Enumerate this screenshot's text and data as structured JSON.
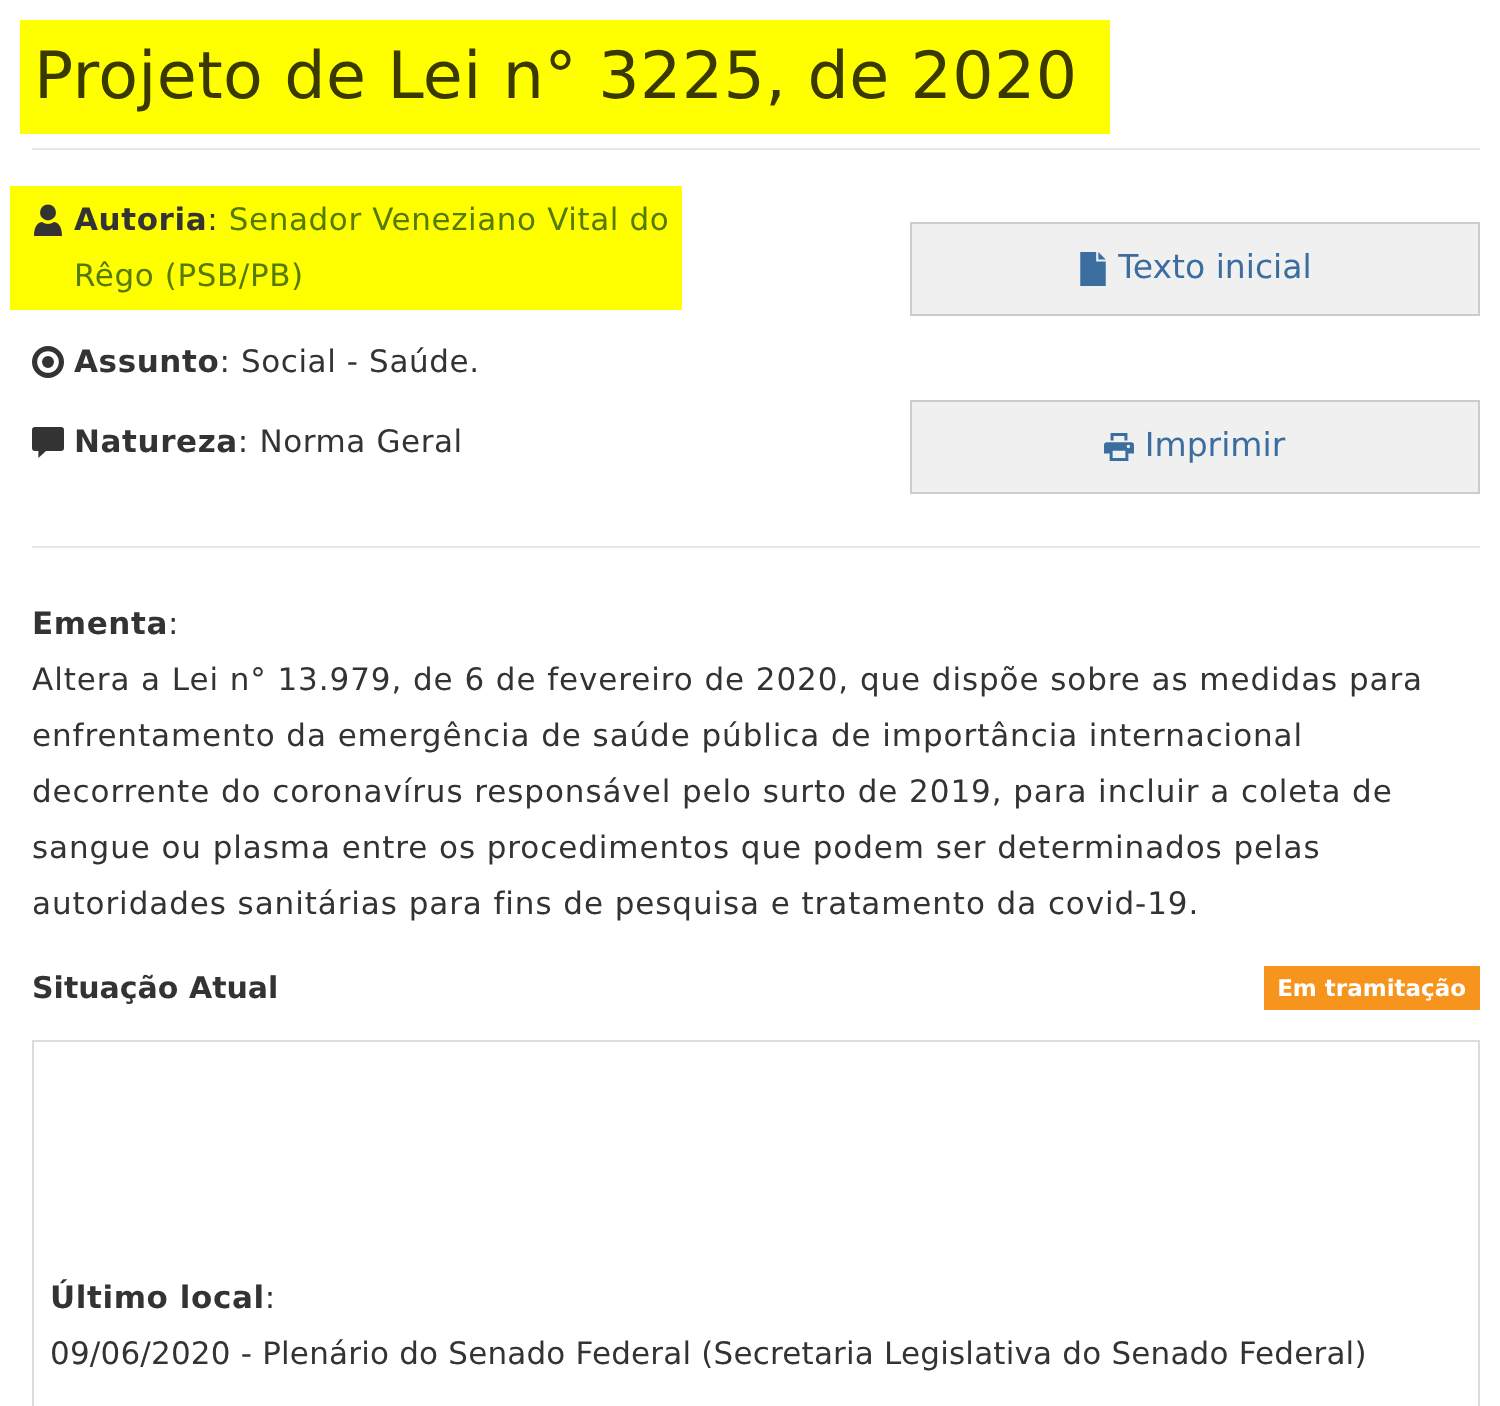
{
  "title": {
    "text": "Projeto de Lei n° 3225, de 2020",
    "highlighted": true
  },
  "fields": [
    {
      "kind": "author",
      "label": "**Autoria**:",
      "value": "Senador Veneziano Vital do Rêgo (PSB/PB)",
      "highlighted": true
    },
    {
      "kind": "subject",
      "label": "**Assunto**:",
      "value": "Social - Saúde.",
      "highlighted": false
    },
    {
      "kind": "nature",
      "label": "**Natureza**:",
      "value": "Norma Geral",
      "highlighted": false
    }
  ],
  "buttons": [
    {
      "kind": "document",
      "label": "Texto inicial"
    },
    {
      "kind": "print",
      "label": "Imprimir"
    }
  ],
  "ementa": {
    "label": "**Ementa**:",
    "text": "Altera a Lei n° 13.979, de 6 de fevereiro de 2020, que dispõe sobre as medidas para enfrentamento da emergência de saúde pública de importância internacional decorrente do coronavírus responsável pelo surto de 2019, para incluir a coleta de sangue ou plasma entre os procedimentos que podem ser determinados pelas autoridades sanitárias para fins de pesquisa e tratamento da covid-19."
  },
  "situacao": {
    "heading": "Situação Atual",
    "status": "Em tramitação",
    "last_location": {
      "label": "**Último local**:",
      "text": "09/06/2020 - Plenário do Senado Federal (Secretaria Legislativa do Senado Federal)"
    }
  }
}
